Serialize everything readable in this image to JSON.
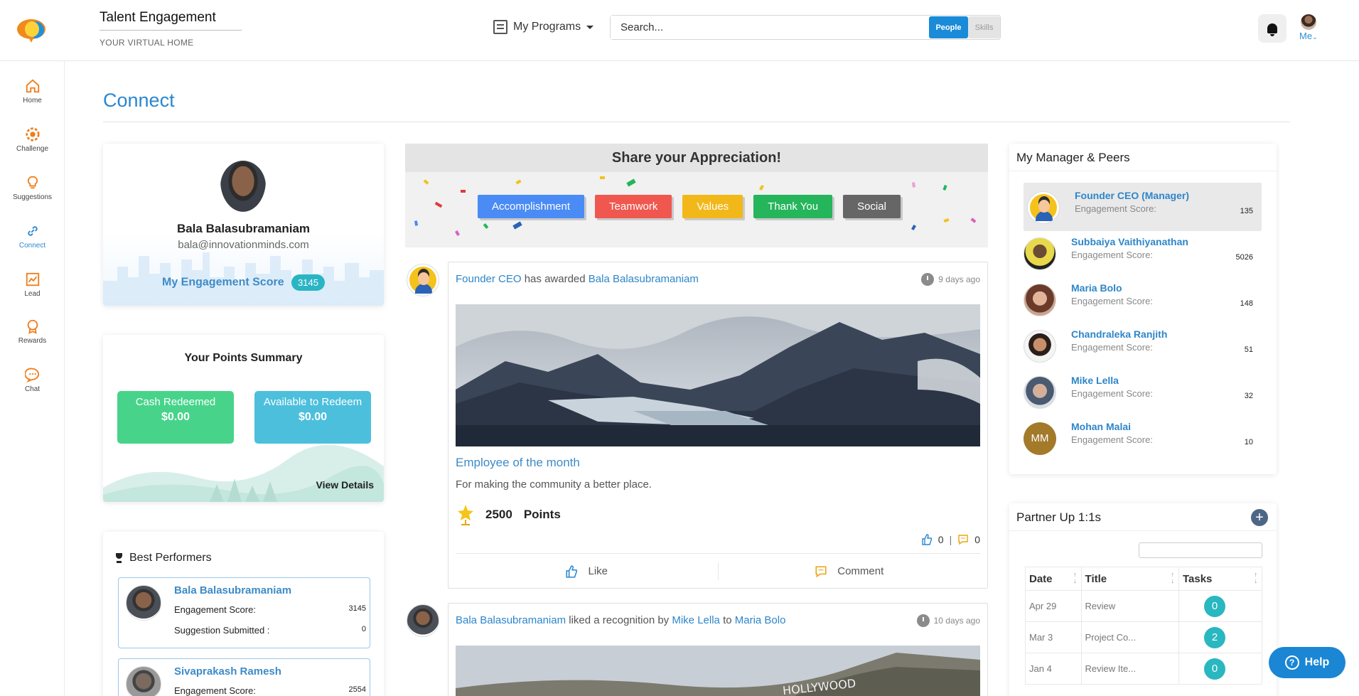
{
  "header": {
    "title": "Talent Engagement",
    "subtitle": "YOUR VIRTUAL HOME",
    "programs_label": "My Programs",
    "search_placeholder": "Search...",
    "toggle_people": "People",
    "toggle_skills": "Skills",
    "me_label": "Me"
  },
  "sidebar": {
    "items": [
      {
        "label": "Home",
        "icon": "home-icon"
      },
      {
        "label": "Challenge",
        "icon": "challenge-icon"
      },
      {
        "label": "Suggestions",
        "icon": "bulb-icon"
      },
      {
        "label": "Connect",
        "icon": "link-icon"
      },
      {
        "label": "Lead",
        "icon": "chart-icon"
      },
      {
        "label": "Rewards",
        "icon": "medal-icon"
      },
      {
        "label": "Chat",
        "icon": "chat-icon"
      }
    ]
  },
  "page": {
    "title": "Connect"
  },
  "profile": {
    "name": "Bala Balasubramaniam",
    "email": "bala@innovationminds.com",
    "score_label": "My Engagement Score",
    "score": "3145"
  },
  "points": {
    "title": "Your Points Summary",
    "cash_label": "Cash Redeemed",
    "cash_value": "$0.00",
    "avail_label": "Available to Redeem",
    "avail_value": "$0.00",
    "view_details": "View Details"
  },
  "best": {
    "title": "Best Performers",
    "engagement_label": "Engagement Score:",
    "suggestion_label": "Suggestion Submitted :",
    "performers": [
      {
        "name": "Bala Balasubramaniam",
        "score": "3145",
        "suggestions": "0"
      },
      {
        "name": "Sivaprakash Ramesh",
        "score": "2554"
      }
    ]
  },
  "share": {
    "title": "Share your Appreciation!",
    "buttons": [
      {
        "label": "Accomplishment",
        "color": "#4a8bf5"
      },
      {
        "label": "Teamwork",
        "color": "#f0574f"
      },
      {
        "label": "Values",
        "color": "#f2b81a"
      },
      {
        "label": "Thank You",
        "color": "#25b55b"
      },
      {
        "label": "Social",
        "color": "#666666"
      }
    ]
  },
  "feed": {
    "post1": {
      "actor": "Founder CEO",
      "verb": "has awarded",
      "target": "Bala Balasubramaniam",
      "time": "9 days ago",
      "title": "Employee of the month",
      "desc": "For making the community a better place.",
      "points": "2500",
      "points_label": "Points",
      "likes": "0",
      "comments": "0",
      "like_label": "Like",
      "comment_label": "Comment"
    },
    "post2": {
      "actor": "Bala Balasubramaniam",
      "verb": "liked a recognition by",
      "by": "Mike Lella",
      "to": "to",
      "target": "Maria Bolo",
      "time": "10 days ago"
    }
  },
  "peers": {
    "title": "My Manager & Peers",
    "score_label": "Engagement Score:",
    "list": [
      {
        "name": "Founder CEO (Manager)",
        "score": "135"
      },
      {
        "name": "Subbaiya Vaithiyanathan",
        "score": "5026"
      },
      {
        "name": "Maria Bolo",
        "score": "148"
      },
      {
        "name": "Chandraleka Ranjith",
        "score": "51"
      },
      {
        "name": "Mike Lella",
        "score": "32"
      },
      {
        "name": "Mohan Malai",
        "score": "10",
        "initials": "MM"
      }
    ]
  },
  "partner": {
    "title": "Partner Up 1:1s",
    "columns": [
      "Date",
      "Title",
      "Tasks"
    ],
    "rows": [
      {
        "date": "Apr 29",
        "title": "Review",
        "tasks": "0"
      },
      {
        "date": "Mar 3",
        "title": "Project Co...",
        "tasks": "2"
      },
      {
        "date": "Jan 4",
        "title": "Review Ite...",
        "tasks": "0"
      }
    ]
  },
  "help": {
    "label": "Help"
  }
}
